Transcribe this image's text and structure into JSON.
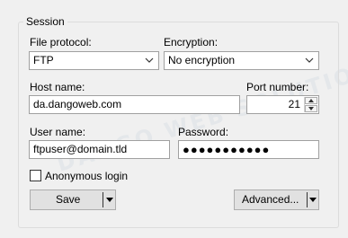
{
  "session": {
    "legend": "Session",
    "file_protocol": {
      "label": "File protocol:",
      "value": "FTP"
    },
    "encryption": {
      "label": "Encryption:",
      "value": "No encryption"
    },
    "host_name": {
      "label": "Host name:",
      "value": "da.dangoweb.com"
    },
    "port_number": {
      "label": "Port number:",
      "value": "21"
    },
    "user_name": {
      "label": "User name:",
      "value": "ftpuser@domain.tld"
    },
    "password": {
      "label": "Password:",
      "masked_value": "●●●●●●●●●●●"
    },
    "anonymous_login": {
      "label": "Anonymous login",
      "checked": false
    },
    "buttons": {
      "save": "Save",
      "advanced": "Advanced..."
    }
  },
  "watermark": "DANGO WEB SOLUTIONS"
}
